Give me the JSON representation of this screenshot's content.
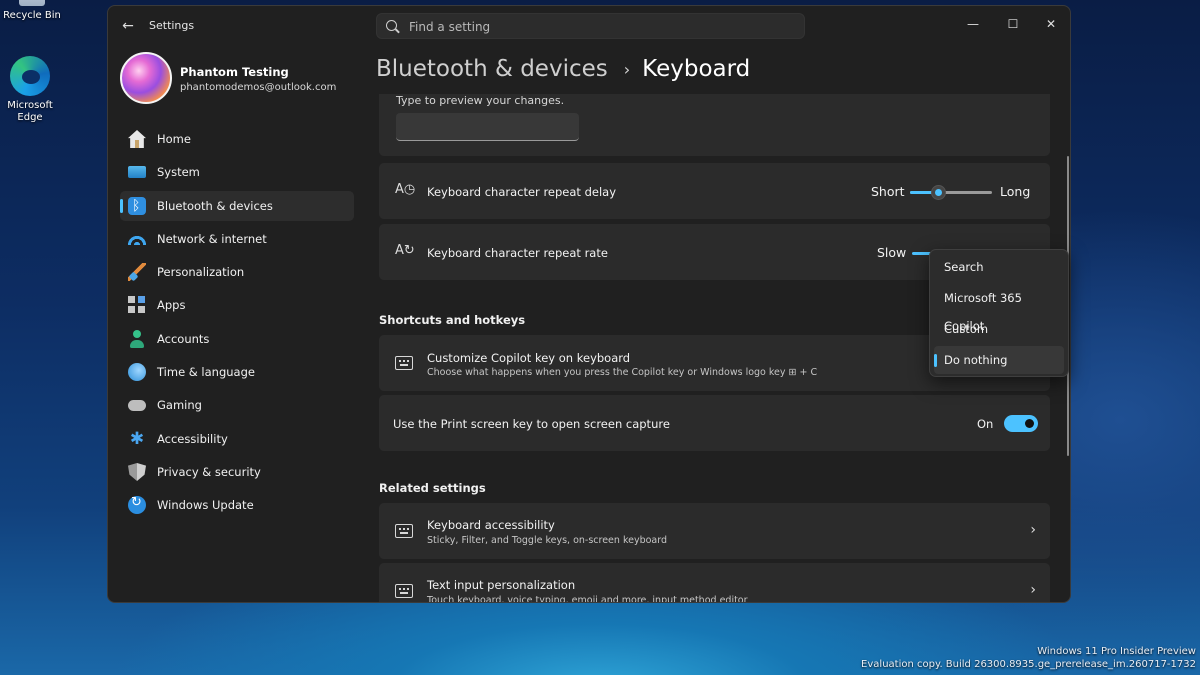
{
  "desktop": {
    "recycle_bin": "Recycle Bin",
    "edge": "Microsoft Edge",
    "watermark_line1": "Windows 11 Pro Insider Preview",
    "watermark_line2": "Evaluation copy. Build 26300.8935.ge_prerelease_im.260717-1732"
  },
  "window": {
    "title": "Settings",
    "search_placeholder": "Find a setting",
    "minimize": "—",
    "maximize": "☐",
    "close": "✕"
  },
  "profile": {
    "name": "Phantom Testing",
    "email": "phantomodemos@outlook.com"
  },
  "sidebar": {
    "items": [
      {
        "label": "Home",
        "icon": "home-icon"
      },
      {
        "label": "System",
        "icon": "system-icon"
      },
      {
        "label": "Bluetooth & devices",
        "icon": "bluetooth-icon",
        "active": true
      },
      {
        "label": "Network & internet",
        "icon": "wifi-icon"
      },
      {
        "label": "Personalization",
        "icon": "brush-icon"
      },
      {
        "label": "Apps",
        "icon": "apps-icon"
      },
      {
        "label": "Accounts",
        "icon": "accounts-icon"
      },
      {
        "label": "Time & language",
        "icon": "globe-clock-icon"
      },
      {
        "label": "Gaming",
        "icon": "gamepad-icon"
      },
      {
        "label": "Accessibility",
        "icon": "accessibility-icon"
      },
      {
        "label": "Privacy & security",
        "icon": "shield-icon"
      },
      {
        "label": "Windows Update",
        "icon": "update-icon"
      }
    ]
  },
  "breadcrumb": {
    "parent": "Bluetooth & devices",
    "separator": "›",
    "current": "Keyboard"
  },
  "preview": {
    "hint": "Type to preview your changes."
  },
  "repeat_delay": {
    "label": "Keyboard character repeat delay",
    "min_label": "Short",
    "max_label": "Long",
    "level": 0.35
  },
  "repeat_rate": {
    "label": "Keyboard character repeat rate",
    "min_label": "Slow"
  },
  "shortcuts": {
    "heading": "Shortcuts and hotkeys",
    "copilot": {
      "label": "Customize Copilot key on keyboard",
      "desc": "Choose what happens when you press the Copilot key or Windows logo key ⊞ + C"
    },
    "print_screen": {
      "label": "Use the Print screen key to open screen capture",
      "state": "On"
    }
  },
  "related": {
    "heading": "Related settings",
    "items": [
      {
        "label": "Keyboard accessibility",
        "desc": "Sticky, Filter, and Toggle keys, on-screen keyboard"
      },
      {
        "label": "Text input personalization",
        "desc": "Touch keyboard, voice typing, emoji and more, input method editor"
      }
    ]
  },
  "copilot_dropdown": {
    "options": [
      "Search",
      "Microsoft 365 Copilot",
      "Custom",
      "Do nothing"
    ],
    "selected": "Do nothing"
  },
  "colors": {
    "accent": "#4cc2ff",
    "window_bg": "#202020",
    "card_bg": "#2b2b2b"
  }
}
